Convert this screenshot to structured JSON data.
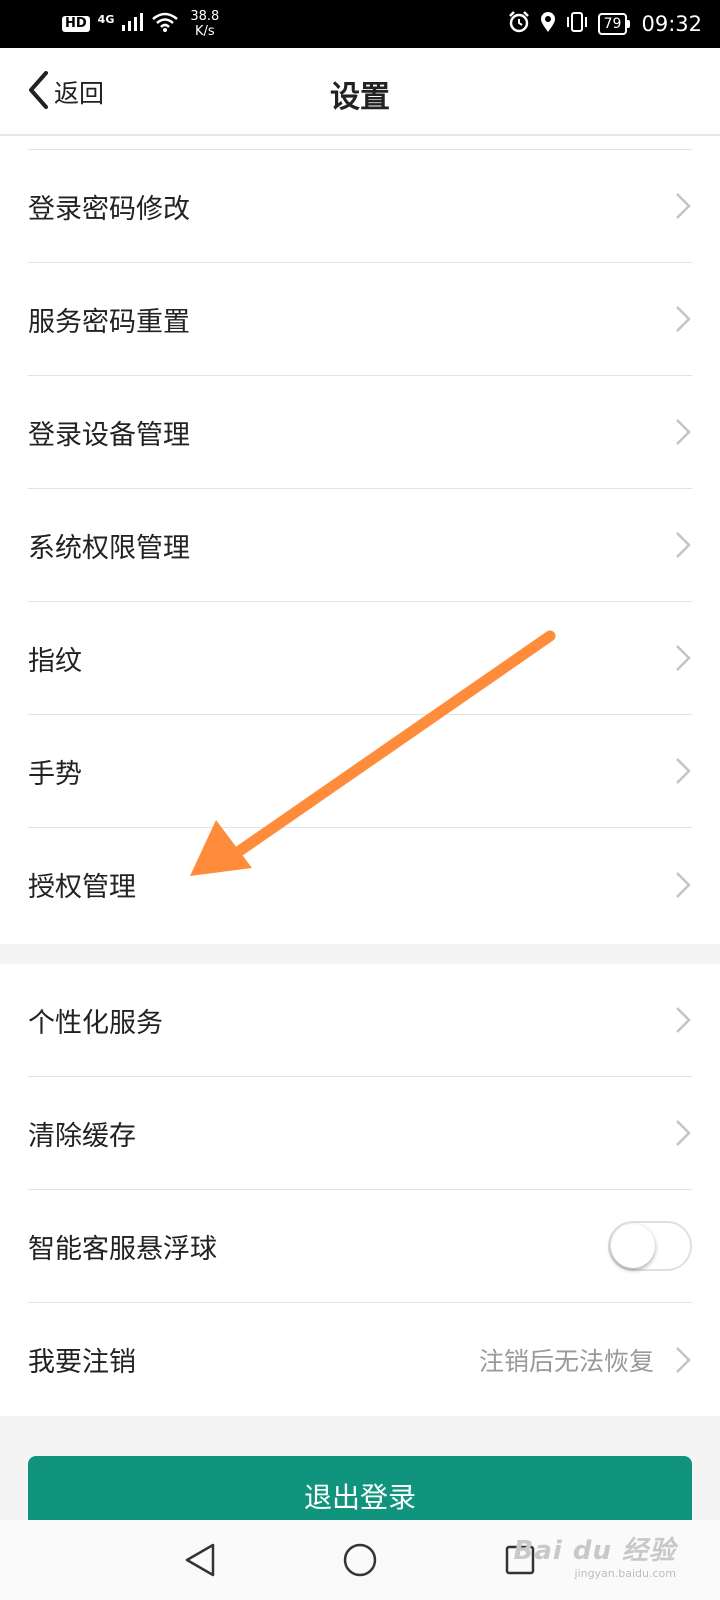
{
  "status_bar": {
    "hd": "HD",
    "network": "4G",
    "speed_value": "38.8",
    "speed_unit": "K/s",
    "battery": "79",
    "time": "09:32"
  },
  "header": {
    "back_label": "返回",
    "title": "设置"
  },
  "group_a": [
    {
      "label": "登录密码修改"
    },
    {
      "label": "服务密码重置"
    },
    {
      "label": "登录设备管理"
    },
    {
      "label": "系统权限管理"
    },
    {
      "label": "指纹"
    },
    {
      "label": "手势"
    },
    {
      "label": "授权管理"
    }
  ],
  "group_b": {
    "personalized": {
      "label": "个性化服务"
    },
    "clear_cache": {
      "label": "清除缓存"
    },
    "float_ball": {
      "label": "智能客服悬浮球",
      "enabled": false
    },
    "deregister": {
      "label": "我要注销",
      "hint": "注销后无法恢复"
    }
  },
  "logout_label": "退出登录",
  "watermark": {
    "main": "Bai du 经验",
    "sub": "jingyan.baidu.com"
  },
  "colors": {
    "accent": "#10947e",
    "annotation_arrow": "#ff8c3a"
  }
}
